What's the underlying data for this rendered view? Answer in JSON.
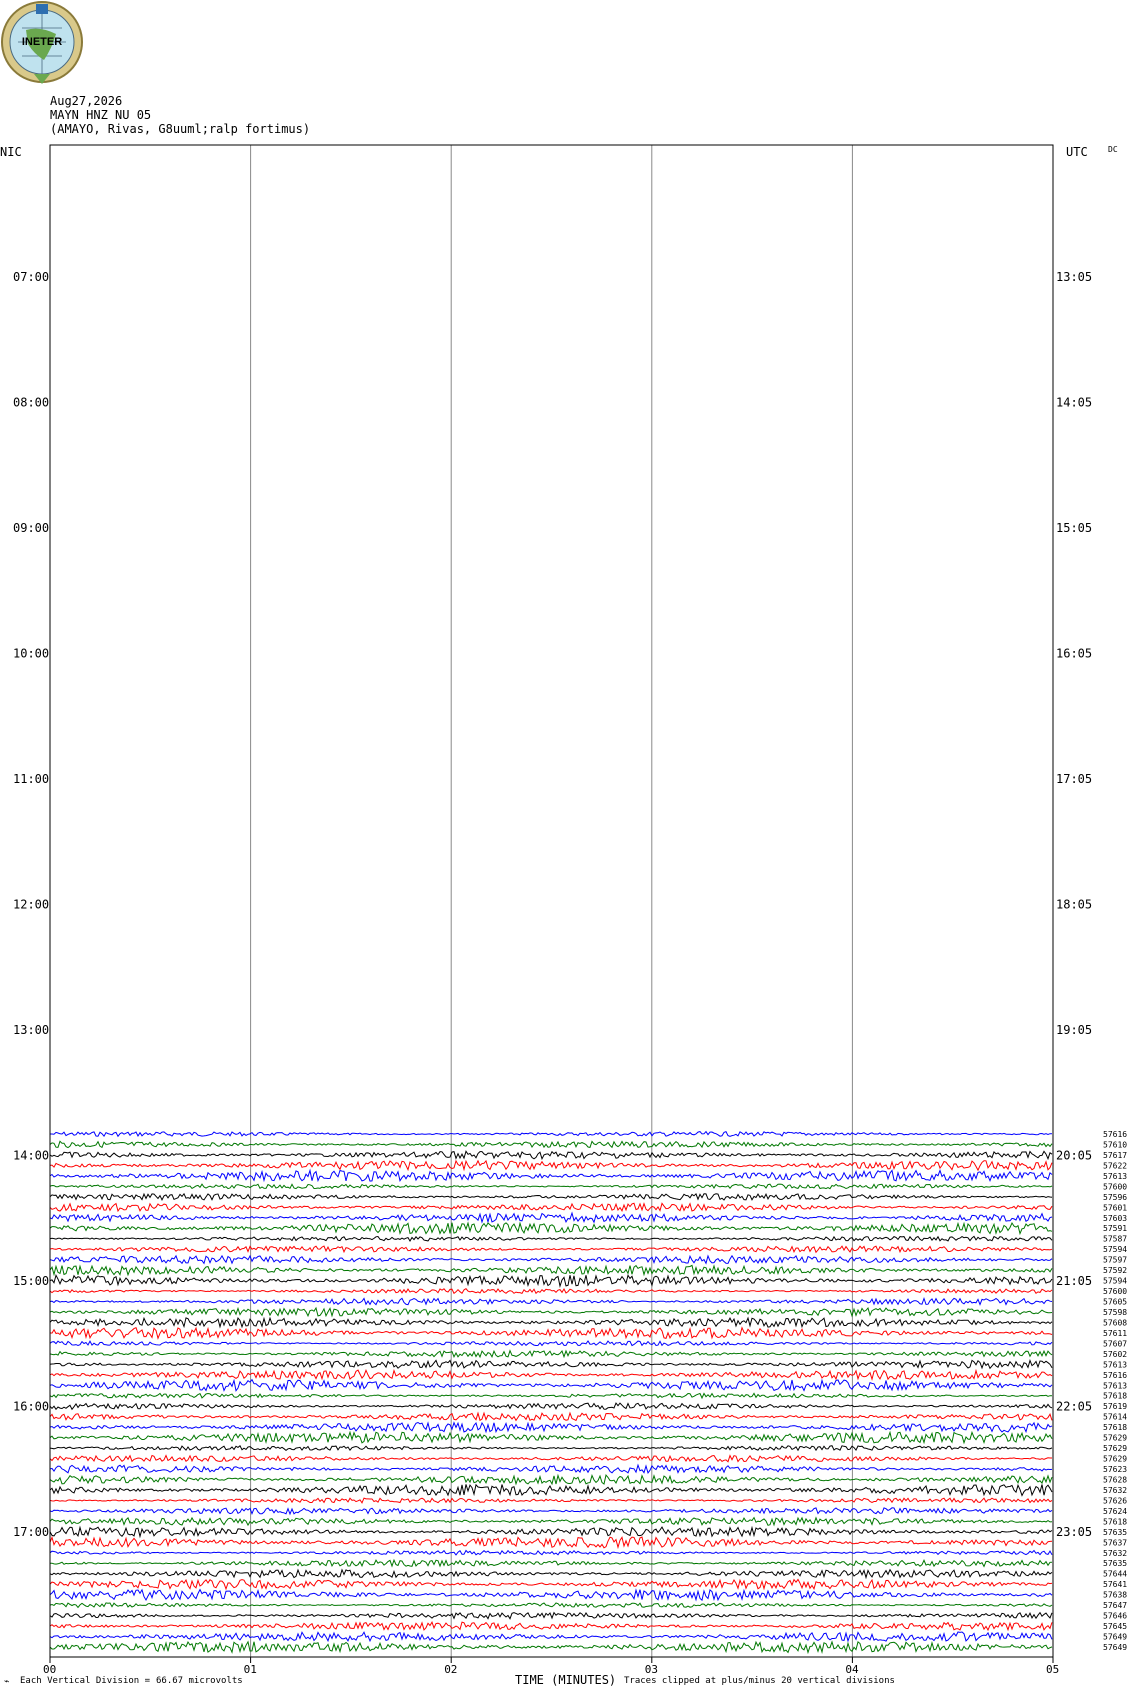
{
  "header": {
    "logo_text": "INETER",
    "date": "Aug27,2026",
    "station": "MAYN HNZ NU 05",
    "location": "(AMAYO, Rivas, G8uuml;ralp fortimus)",
    "left_tz": "NIC",
    "right_tz": "UTC",
    "dc": "DC"
  },
  "footer": {
    "vertical_division": "Each Vertical Division =",
    "microvolts": "66.67 microvolts",
    "xlabel": "TIME (MINUTES)",
    "clip_note": "Traces clipped at plus/minus 20 vertical divisions"
  },
  "colors": {
    "black": "#000000",
    "red": "#ff0000",
    "blue": "#0000ff",
    "green": "#007700",
    "grid": "#888888"
  },
  "chart_data": {
    "type": "line",
    "title": "MAYN HNZ NU 05",
    "xlabel": "TIME (MINUTES)",
    "x_ticks": [
      "00",
      "01",
      "02",
      "03",
      "04",
      "05"
    ],
    "xlim": [
      0,
      5
    ],
    "left_hour_labels": [
      "07:00",
      "08:00",
      "09:00",
      "10:00",
      "11:00",
      "12:00",
      "13:00",
      "14:00",
      "15:00",
      "16:00",
      "17:00"
    ],
    "right_hour_labels": [
      "13:05",
      "14:05",
      "15:05",
      "16:05",
      "17:05",
      "18:05",
      "19:05",
      "20:05",
      "21:05",
      "22:05",
      "23:05"
    ],
    "trace_colors_cycle": [
      "blue",
      "green",
      "black",
      "red"
    ],
    "trace_labels": [
      "57616",
      "57610",
      "57617",
      "57622",
      "57613",
      "57600",
      "57596",
      "57601",
      "57603",
      "57591",
      "57587",
      "57594",
      "57597",
      "57592",
      "57594",
      "57600",
      "57605",
      "57598",
      "57608",
      "57611",
      "57607",
      "57602",
      "57613",
      "57616",
      "57613",
      "57618",
      "57619",
      "57614",
      "57618",
      "57629",
      "57629",
      "57629",
      "57623",
      "57628",
      "57632",
      "57626",
      "57624",
      "57618",
      "57635",
      "57637",
      "57632",
      "57635",
      "57644",
      "57641",
      "57638",
      "57647",
      "57646",
      "57645",
      "57649",
      "57649"
    ]
  }
}
